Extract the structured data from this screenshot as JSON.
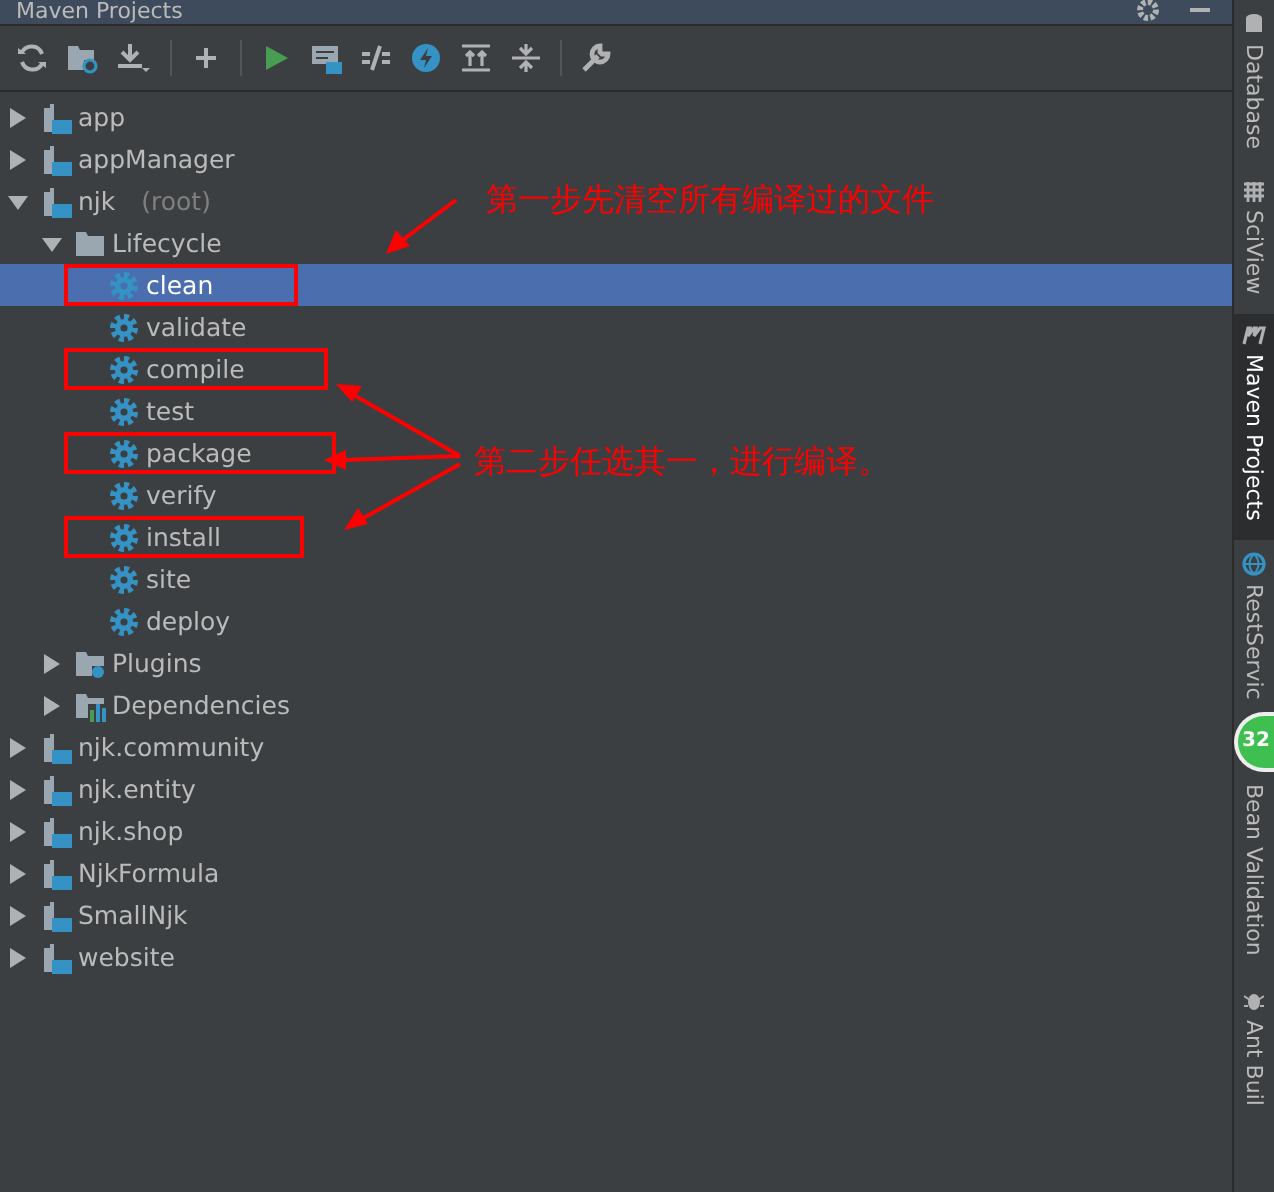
{
  "window": {
    "title": "Maven Projects"
  },
  "tree": [
    {
      "label": "app",
      "kind": "module",
      "expanded": false,
      "selected": false
    },
    {
      "label": "appManager",
      "kind": "module",
      "expanded": false,
      "selected": false
    },
    {
      "label": "njk",
      "suffix": "(root)",
      "kind": "module",
      "expanded": true,
      "selected": false,
      "children": [
        {
          "label": "Lifecycle",
          "kind": "folder",
          "expanded": true,
          "selected": false,
          "children": [
            {
              "label": "clean",
              "kind": "goal",
              "selected": true,
              "marked": true
            },
            {
              "label": "validate",
              "kind": "goal",
              "selected": false,
              "marked": false
            },
            {
              "label": "compile",
              "kind": "goal",
              "selected": false,
              "marked": true
            },
            {
              "label": "test",
              "kind": "goal",
              "selected": false,
              "marked": false
            },
            {
              "label": "package",
              "kind": "goal",
              "selected": false,
              "marked": true
            },
            {
              "label": "verify",
              "kind": "goal",
              "selected": false,
              "marked": false
            },
            {
              "label": "install",
              "kind": "goal",
              "selected": false,
              "marked": true
            },
            {
              "label": "site",
              "kind": "goal",
              "selected": false,
              "marked": false
            },
            {
              "label": "deploy",
              "kind": "goal",
              "selected": false,
              "marked": false
            }
          ]
        },
        {
          "label": "Plugins",
          "kind": "plugins",
          "expanded": false,
          "selected": false
        },
        {
          "label": "Dependencies",
          "kind": "dependencies",
          "expanded": false,
          "selected": false
        }
      ]
    },
    {
      "label": "njk.community",
      "kind": "module",
      "expanded": false,
      "selected": false
    },
    {
      "label": "njk.entity",
      "kind": "module",
      "expanded": false,
      "selected": false
    },
    {
      "label": "njk.shop",
      "kind": "module",
      "expanded": false,
      "selected": false
    },
    {
      "label": "NjkFormula",
      "kind": "module",
      "expanded": false,
      "selected": false
    },
    {
      "label": "SmallNjk",
      "kind": "module",
      "expanded": false,
      "selected": false
    },
    {
      "label": "website",
      "kind": "module",
      "expanded": false,
      "selected": false
    }
  ],
  "annotations": [
    {
      "text": "第一步先清空所有编译过的文件"
    },
    {
      "text": "第二步任选其一，进行编译。"
    }
  ],
  "side_tabs": [
    {
      "label": "Database",
      "selected": false
    },
    {
      "label": "SciView",
      "selected": false
    },
    {
      "label": "Maven Projects",
      "selected": true
    },
    {
      "label": "RestServic",
      "selected": false
    },
    {
      "label": "Bean Validation",
      "selected": false
    },
    {
      "label": "Ant Buil",
      "selected": false
    }
  ],
  "badge": {
    "text": "32"
  }
}
